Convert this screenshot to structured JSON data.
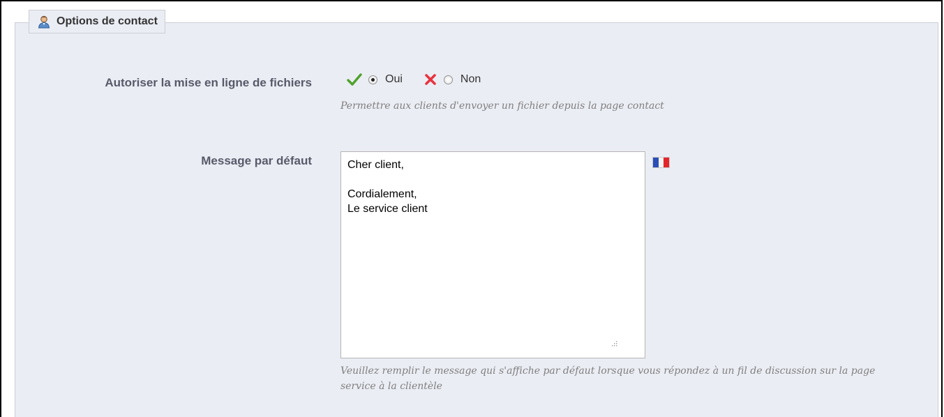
{
  "section": {
    "title": "Options de contact",
    "icon": "user-icon"
  },
  "upload": {
    "label": "Autoriser la mise en ligne de fichiers",
    "yes_label": "Oui",
    "no_label": "Non",
    "selected": "Oui",
    "hint": "Permettre aux clients d'envoyer un fichier depuis la page contact"
  },
  "message": {
    "label": "Message par défaut",
    "value": "Cher client,\n\nCordialement,\nLe service client",
    "language_flag": "flag-fr-icon",
    "hint": "Veuillez remplir le message qui s'affiche par défaut lorsque vous répondez à un fil de discussion sur la page service à la clientèle"
  },
  "colors": {
    "panel_bg": "#ebedf4",
    "label": "#585a69",
    "check": "#4fa12c",
    "cross": "#e8333f"
  }
}
